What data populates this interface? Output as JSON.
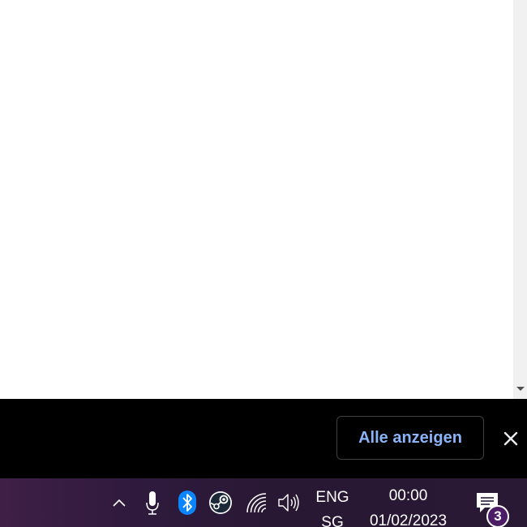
{
  "download_bar": {
    "show_all_label": "Alle anzeigen",
    "close_icon": "close-icon"
  },
  "taskbar": {
    "tray_icons": [
      "chevron-up-icon",
      "microphone-icon",
      "bluetooth-icon",
      "steam-icon",
      "wifi-icon",
      "volume-icon"
    ],
    "language": {
      "line1": "ENG",
      "line2": "SG"
    },
    "clock": {
      "time": "00:00",
      "date": "01/02/2023"
    },
    "notifications": {
      "icon": "notification-center-icon",
      "count": "3"
    }
  },
  "colors": {
    "accent_link": "#8ab4f8",
    "download_bar_bg": "#000000",
    "taskbar_bg": "#2a1935",
    "bluetooth_blue": "#0a84ff",
    "badge_bg": "#4d1c66"
  }
}
